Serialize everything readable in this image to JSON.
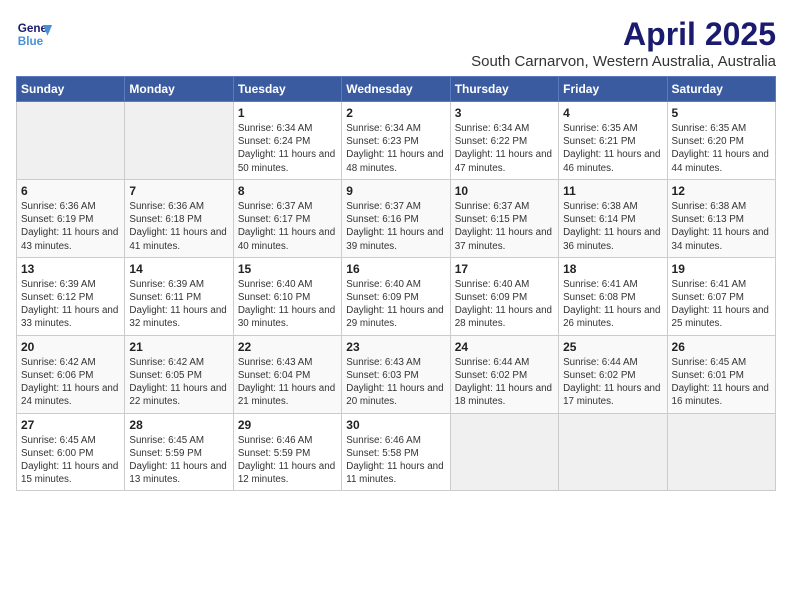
{
  "logo": {
    "line1": "General",
    "line2": "Blue"
  },
  "title": "April 2025",
  "subtitle": "South Carnarvon, Western Australia, Australia",
  "headers": [
    "Sunday",
    "Monday",
    "Tuesday",
    "Wednesday",
    "Thursday",
    "Friday",
    "Saturday"
  ],
  "weeks": [
    [
      {
        "day": "",
        "info": ""
      },
      {
        "day": "",
        "info": ""
      },
      {
        "day": "1",
        "info": "Sunrise: 6:34 AM\nSunset: 6:24 PM\nDaylight: 11 hours and 50 minutes."
      },
      {
        "day": "2",
        "info": "Sunrise: 6:34 AM\nSunset: 6:23 PM\nDaylight: 11 hours and 48 minutes."
      },
      {
        "day": "3",
        "info": "Sunrise: 6:34 AM\nSunset: 6:22 PM\nDaylight: 11 hours and 47 minutes."
      },
      {
        "day": "4",
        "info": "Sunrise: 6:35 AM\nSunset: 6:21 PM\nDaylight: 11 hours and 46 minutes."
      },
      {
        "day": "5",
        "info": "Sunrise: 6:35 AM\nSunset: 6:20 PM\nDaylight: 11 hours and 44 minutes."
      }
    ],
    [
      {
        "day": "6",
        "info": "Sunrise: 6:36 AM\nSunset: 6:19 PM\nDaylight: 11 hours and 43 minutes."
      },
      {
        "day": "7",
        "info": "Sunrise: 6:36 AM\nSunset: 6:18 PM\nDaylight: 11 hours and 41 minutes."
      },
      {
        "day": "8",
        "info": "Sunrise: 6:37 AM\nSunset: 6:17 PM\nDaylight: 11 hours and 40 minutes."
      },
      {
        "day": "9",
        "info": "Sunrise: 6:37 AM\nSunset: 6:16 PM\nDaylight: 11 hours and 39 minutes."
      },
      {
        "day": "10",
        "info": "Sunrise: 6:37 AM\nSunset: 6:15 PM\nDaylight: 11 hours and 37 minutes."
      },
      {
        "day": "11",
        "info": "Sunrise: 6:38 AM\nSunset: 6:14 PM\nDaylight: 11 hours and 36 minutes."
      },
      {
        "day": "12",
        "info": "Sunrise: 6:38 AM\nSunset: 6:13 PM\nDaylight: 11 hours and 34 minutes."
      }
    ],
    [
      {
        "day": "13",
        "info": "Sunrise: 6:39 AM\nSunset: 6:12 PM\nDaylight: 11 hours and 33 minutes."
      },
      {
        "day": "14",
        "info": "Sunrise: 6:39 AM\nSunset: 6:11 PM\nDaylight: 11 hours and 32 minutes."
      },
      {
        "day": "15",
        "info": "Sunrise: 6:40 AM\nSunset: 6:10 PM\nDaylight: 11 hours and 30 minutes."
      },
      {
        "day": "16",
        "info": "Sunrise: 6:40 AM\nSunset: 6:09 PM\nDaylight: 11 hours and 29 minutes."
      },
      {
        "day": "17",
        "info": "Sunrise: 6:40 AM\nSunset: 6:09 PM\nDaylight: 11 hours and 28 minutes."
      },
      {
        "day": "18",
        "info": "Sunrise: 6:41 AM\nSunset: 6:08 PM\nDaylight: 11 hours and 26 minutes."
      },
      {
        "day": "19",
        "info": "Sunrise: 6:41 AM\nSunset: 6:07 PM\nDaylight: 11 hours and 25 minutes."
      }
    ],
    [
      {
        "day": "20",
        "info": "Sunrise: 6:42 AM\nSunset: 6:06 PM\nDaylight: 11 hours and 24 minutes."
      },
      {
        "day": "21",
        "info": "Sunrise: 6:42 AM\nSunset: 6:05 PM\nDaylight: 11 hours and 22 minutes."
      },
      {
        "day": "22",
        "info": "Sunrise: 6:43 AM\nSunset: 6:04 PM\nDaylight: 11 hours and 21 minutes."
      },
      {
        "day": "23",
        "info": "Sunrise: 6:43 AM\nSunset: 6:03 PM\nDaylight: 11 hours and 20 minutes."
      },
      {
        "day": "24",
        "info": "Sunrise: 6:44 AM\nSunset: 6:02 PM\nDaylight: 11 hours and 18 minutes."
      },
      {
        "day": "25",
        "info": "Sunrise: 6:44 AM\nSunset: 6:02 PM\nDaylight: 11 hours and 17 minutes."
      },
      {
        "day": "26",
        "info": "Sunrise: 6:45 AM\nSunset: 6:01 PM\nDaylight: 11 hours and 16 minutes."
      }
    ],
    [
      {
        "day": "27",
        "info": "Sunrise: 6:45 AM\nSunset: 6:00 PM\nDaylight: 11 hours and 15 minutes."
      },
      {
        "day": "28",
        "info": "Sunrise: 6:45 AM\nSunset: 5:59 PM\nDaylight: 11 hours and 13 minutes."
      },
      {
        "day": "29",
        "info": "Sunrise: 6:46 AM\nSunset: 5:59 PM\nDaylight: 11 hours and 12 minutes."
      },
      {
        "day": "30",
        "info": "Sunrise: 6:46 AM\nSunset: 5:58 PM\nDaylight: 11 hours and 11 minutes."
      },
      {
        "day": "",
        "info": ""
      },
      {
        "day": "",
        "info": ""
      },
      {
        "day": "",
        "info": ""
      }
    ]
  ]
}
